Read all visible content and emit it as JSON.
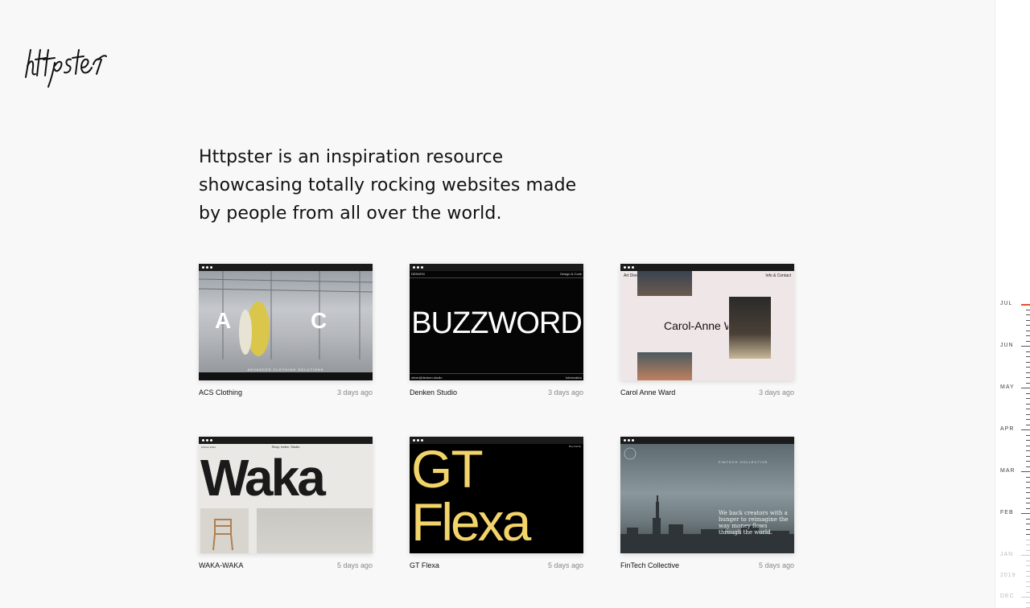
{
  "intro": {
    "lines": [
      "Httpster is an inspiration resource",
      "showcasing totally rocking websites made",
      "by people from all over the world."
    ]
  },
  "sites": [
    {
      "name": "ACS Clothing",
      "time": "3 days ago",
      "thumb": {
        "letters": "A C S",
        "caption": "ADVANCED CLOTHING SOLUTIONS"
      }
    },
    {
      "name": "Denken Studio",
      "time": "3 days ago",
      "thumb": {
        "top_left": "DENKEN",
        "top_right": "Design & Code",
        "headline": "BUZZWORD",
        "bottom_left": "oliver@denken.studio",
        "bottom_right": "Information"
      }
    },
    {
      "name": "Carol Anne Ward",
      "time": "3 days ago",
      "thumb": {
        "top_left": "Art Director & Costume Designer",
        "top_right": "Info & Contact",
        "headline": "Carol-Anne Ward"
      }
    },
    {
      "name": "WAKA-WAKA",
      "time": "5 days ago",
      "thumb": {
        "top_left": "Archive Index",
        "top_center": "Shop, Index, Studio",
        "headline": "Waka"
      }
    },
    {
      "name": "GT Flexa",
      "time": "5 days ago",
      "thumb": {
        "top_right": "Buy Family",
        "line1": "GT",
        "line2": "Flexa"
      }
    },
    {
      "name": "FinTech Collective",
      "time": "5 days ago",
      "thumb": {
        "kicker": "FINTECH COLLECTIVE",
        "body": "We back creators with a hunger to reimagine the way money flows through the world."
      }
    }
  ],
  "timeline": {
    "labels": [
      "JUL",
      "JUN",
      "MAY",
      "APR",
      "MAR",
      "FEB",
      "JAN",
      "2019",
      "DEC"
    ],
    "current": "JUL"
  }
}
